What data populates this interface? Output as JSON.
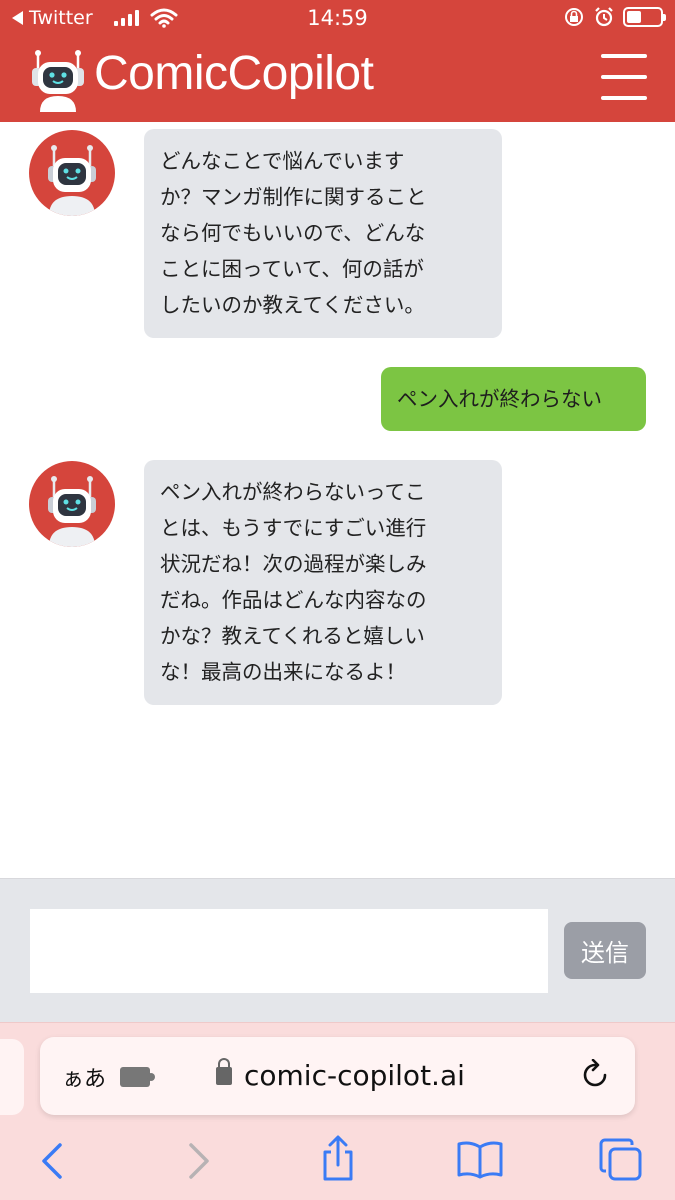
{
  "status_bar": {
    "back_app": "Twitter",
    "time": "14:59"
  },
  "header": {
    "brand": "ComicCopilot"
  },
  "messages": [
    {
      "role": "bot",
      "text": "どんなことで悩んでいます\nか？マンガ制作に関すること\nなら何でもいいので、どんな\nことに困っていて、何の話が\nしたいのか教えてください。"
    },
    {
      "role": "user",
      "text": "ペン入れが終わらない"
    },
    {
      "role": "bot",
      "text": "ペン入れが終わらないってこ\nとは、もうすでにすごい進行\n状況だね！次の過程が楽しみ\nだね。作品はどんな内容なの\nかな？教えてくれると嬉しい\nな！最高の出来になるよ！"
    }
  ],
  "composer": {
    "value": "",
    "send_label": "送信"
  },
  "browser": {
    "aa_label": "ぁあ",
    "url": "comic-copilot.ai"
  },
  "colors": {
    "brand_red": "#d5453c",
    "bot_bubble": "#e4e6ea",
    "user_bubble": "#7cc543",
    "send_button": "#9b9ea6"
  }
}
